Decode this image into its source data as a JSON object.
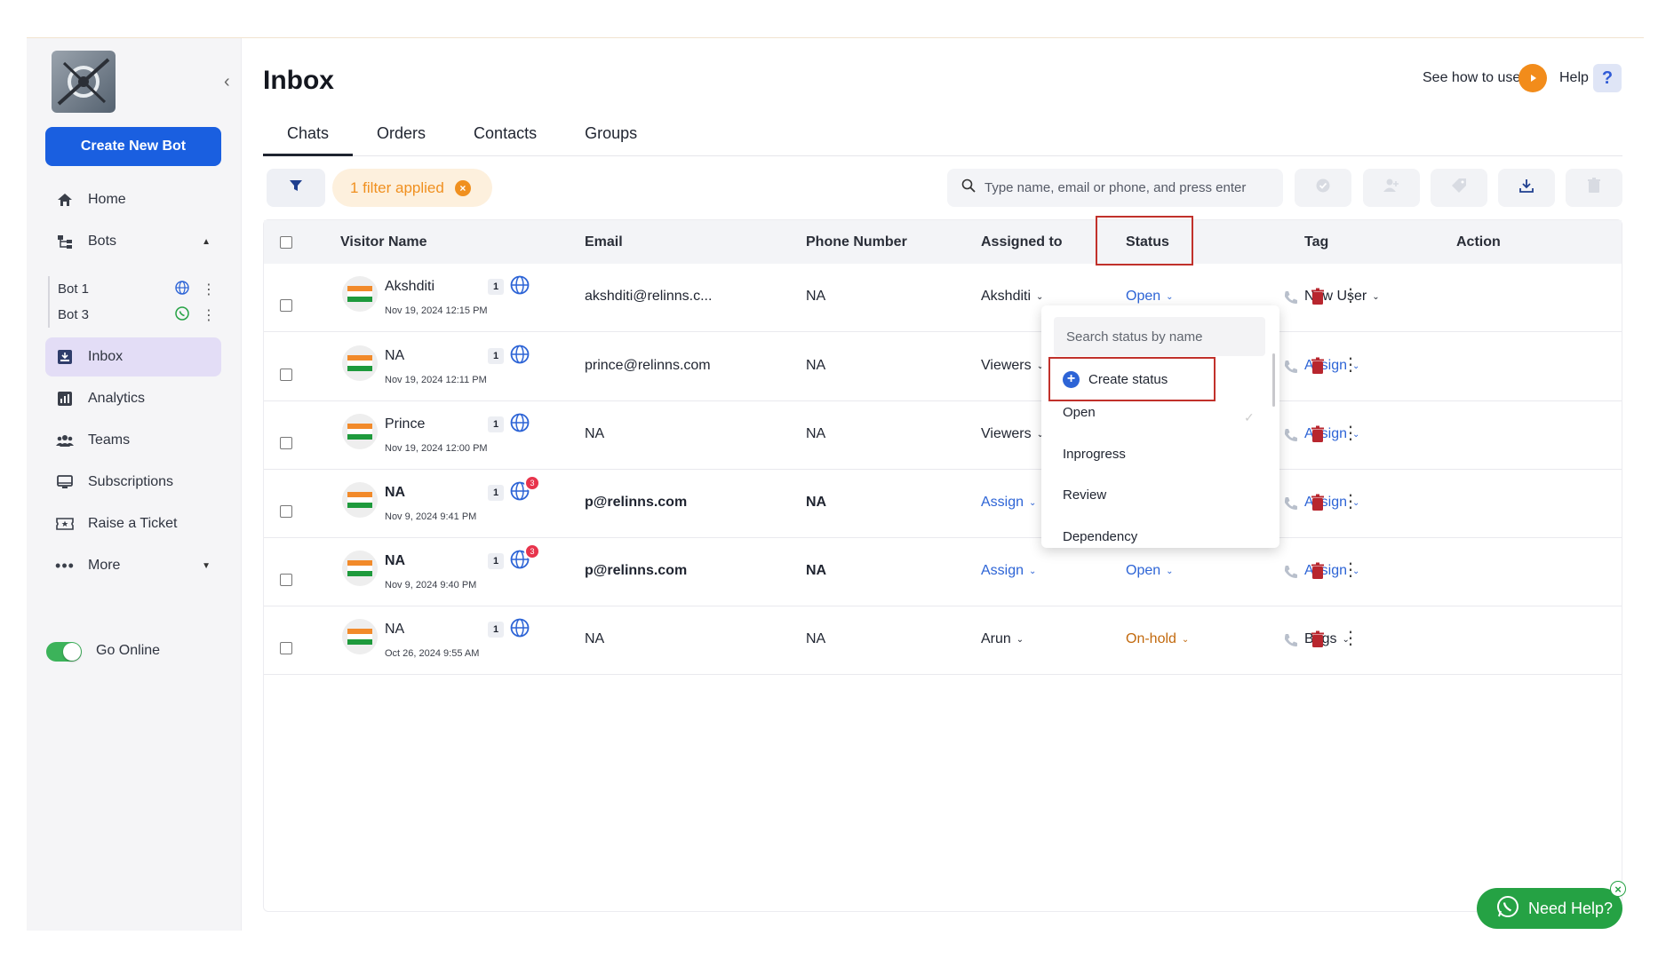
{
  "sidebar": {
    "create_bot_label": "Create New Bot",
    "nav": {
      "home": "Home",
      "bots": "Bots",
      "inbox": "Inbox",
      "analytics": "Analytics",
      "teams": "Teams",
      "subscriptions": "Subscriptions",
      "raise_ticket": "Raise a Ticket",
      "more": "More"
    },
    "bots": [
      {
        "name": "Bot 1",
        "channel": "globe-icon"
      },
      {
        "name": "Bot 3",
        "channel": "whatsapp-icon"
      }
    ],
    "go_online": "Go Online"
  },
  "header": {
    "title": "Inbox",
    "see_how": "See how to use",
    "help": "Help",
    "help_icon_text": "?"
  },
  "tabs": [
    "Chats",
    "Orders",
    "Contacts",
    "Groups"
  ],
  "toolbar": {
    "filter_chip": "1 filter applied",
    "search_placeholder": "Type name, email or phone, and press enter"
  },
  "table": {
    "columns": {
      "visitor": "Visitor Name",
      "email": "Email",
      "phone": "Phone Number",
      "assigned": "Assigned to",
      "status": "Status",
      "tag": "Tag",
      "action": "Action"
    },
    "rows": [
      {
        "name": "Akshditi",
        "date": "Nov 19, 2024 12:15 PM",
        "count": "1",
        "unread": "",
        "email": "akshditi@relinns.c...",
        "phone": "NA",
        "assigned": "Akshditi",
        "status": "Open",
        "tag": "New User"
      },
      {
        "name": "NA",
        "date": "Nov 19, 2024 12:11 PM",
        "count": "1",
        "unread": "",
        "email": "prince@relinns.com",
        "phone": "NA",
        "assigned": "Viewers",
        "status": "",
        "tag": "Assign"
      },
      {
        "name": "Prince",
        "date": "Nov 19, 2024 12:00 PM",
        "count": "1",
        "unread": "",
        "email": "NA",
        "phone": "NA",
        "assigned": "Viewers",
        "status": "",
        "tag": "Assign"
      },
      {
        "name": "NA",
        "date": "Nov 9, 2024 9:41 PM",
        "count": "1",
        "unread": "3",
        "email": "p@relinns.com",
        "phone": "NA",
        "assigned": "Assign",
        "status": "",
        "tag": "Assign"
      },
      {
        "name": "NA",
        "date": "Nov 9, 2024 9:40 PM",
        "count": "1",
        "unread": "3",
        "email": "p@relinns.com",
        "phone": "NA",
        "assigned": "Assign",
        "status": "Open",
        "tag": "Assign"
      },
      {
        "name": "NA",
        "date": "Oct 26, 2024 9:55 AM",
        "count": "1",
        "unread": "",
        "email": "NA",
        "phone": "NA",
        "assigned": "Arun",
        "status": "On-hold",
        "tag": "Bags"
      }
    ]
  },
  "status_dropdown": {
    "search_placeholder": "Search status by name",
    "create_label": "Create status",
    "options": [
      "Open",
      "Inprogress",
      "Review",
      "Dependency"
    ]
  },
  "need_help": {
    "label": "Need Help?",
    "close": "×"
  },
  "colors": {
    "primary": "#1a5fe0",
    "link_blue": "#2d64d6",
    "filter_orange": "#f0901f",
    "on_hold": "#c2690d",
    "delete_red": "#b8262e",
    "highlight_box": "#c1312b",
    "whatsapp_green": "#25a244"
  }
}
